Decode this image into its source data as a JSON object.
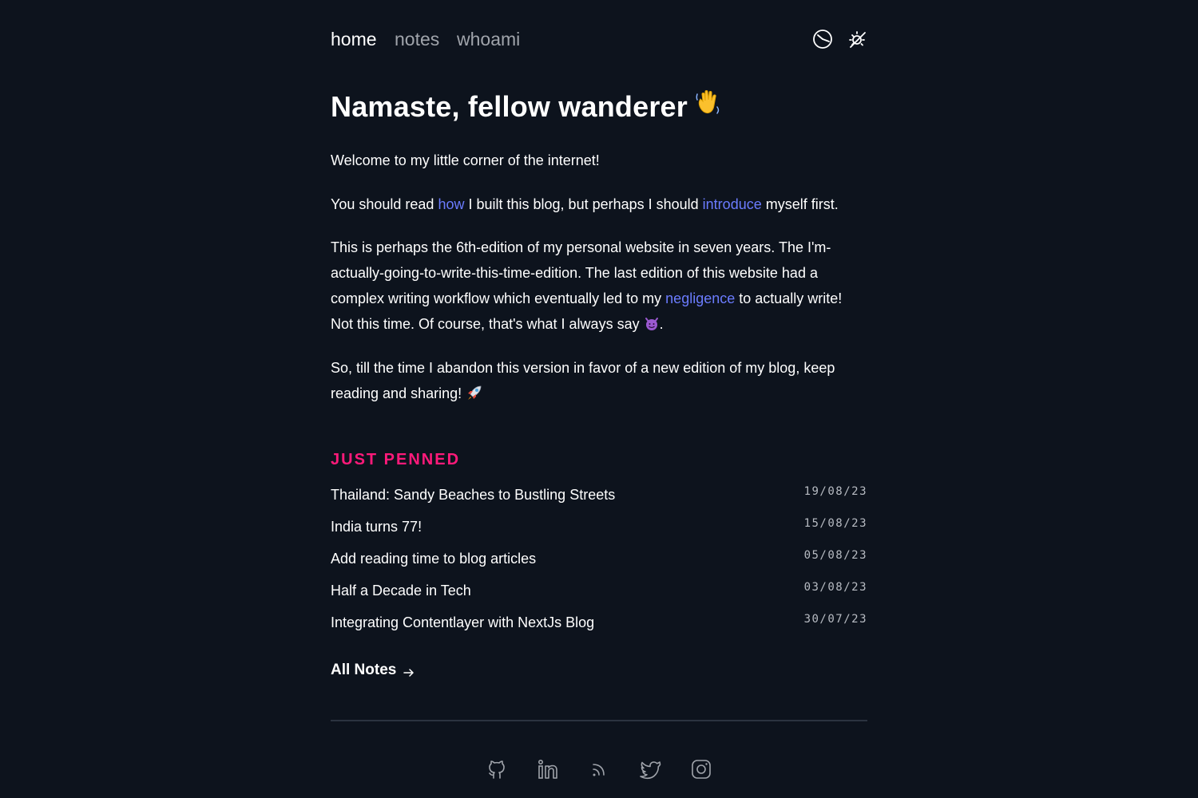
{
  "nav": {
    "items": [
      {
        "label": "home",
        "active": true
      },
      {
        "label": "notes",
        "active": false
      },
      {
        "label": "whoami",
        "active": false
      }
    ],
    "icons": [
      "clock-icon",
      "theme-toggle-icon"
    ]
  },
  "hero": {
    "title": "Namaste, fellow wanderer",
    "title_emoji": "waving-hand-icon"
  },
  "intro": {
    "p1": "Welcome to my little corner of the internet!",
    "p2": {
      "a": "You should read ",
      "link1": "how",
      "b": " I built this blog, but perhaps I should ",
      "link2": "introduce",
      "c": " myself first."
    },
    "p3": {
      "a": "This is perhaps the 6th-edition of my personal website in seven years. The I'm-actually-going-to-write-this-time-edition. The last edition of this website had a complex writing workflow which eventually led to my ",
      "link": "negligence",
      "b": " to actually write! Not this time. Of course, that's what I always say ",
      "c": "."
    },
    "p4": {
      "a": "So, till the time I abandon this version in favor of a new edition of my blog, keep reading and sharing! "
    }
  },
  "just_penned": {
    "heading": "JUST PENNED",
    "posts": [
      {
        "title": "Thailand: Sandy Beaches to Bustling Streets",
        "date": "19/08/23"
      },
      {
        "title": "India turns 77!",
        "date": "15/08/23"
      },
      {
        "title": "Add reading time to blog articles",
        "date": "05/08/23"
      },
      {
        "title": "Half a Decade in Tech",
        "date": "03/08/23"
      },
      {
        "title": "Integrating Contentlayer with NextJs Blog",
        "date": "30/07/23"
      }
    ],
    "all_notes_label": "All Notes"
  },
  "footer": {
    "social": [
      "github-icon",
      "linkedin-icon",
      "rss-icon",
      "twitter-icon",
      "instagram-icon"
    ]
  },
  "colors": {
    "background": "#0d131d",
    "accent_pink": "#ff1a7a",
    "link_blue": "#6b7cff",
    "muted": "#a0a4ab"
  }
}
